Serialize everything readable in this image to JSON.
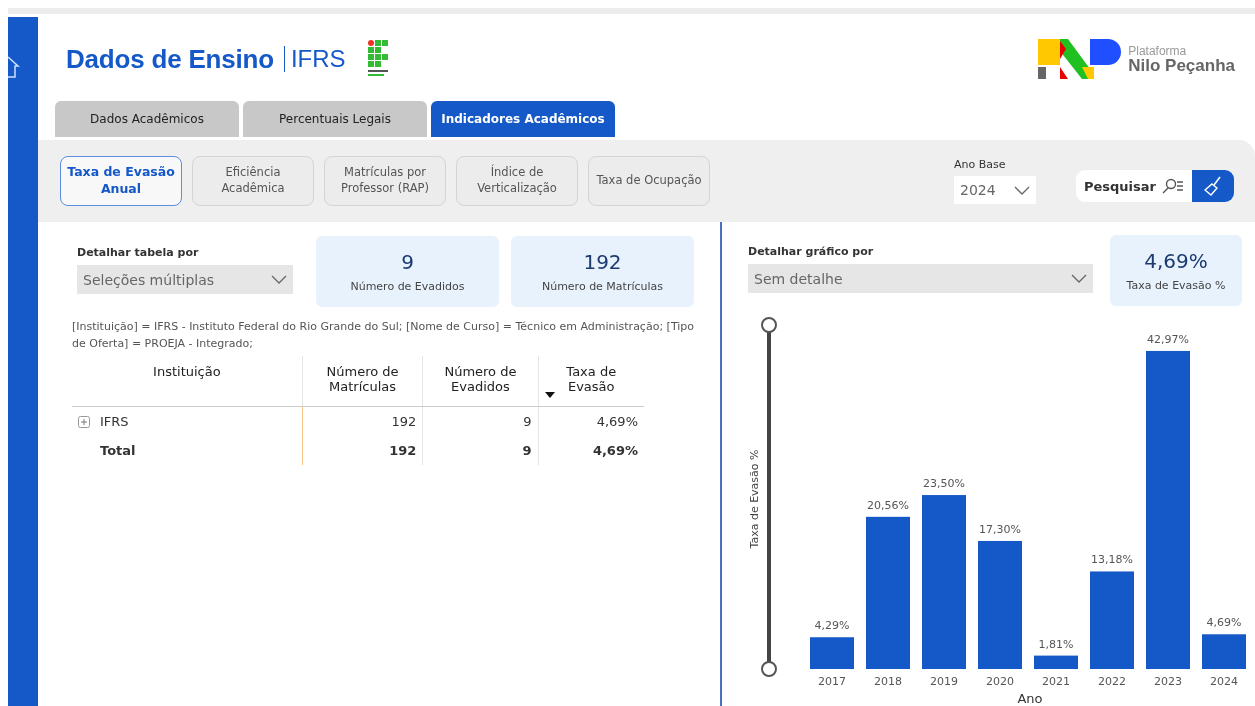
{
  "header": {
    "title": "Dados de Ensino",
    "subtitle": "IFRS",
    "brand": {
      "line1": "Plataforma",
      "line2": "Nilo Peçanha"
    }
  },
  "tabs": [
    {
      "label": "Dados Acadêmicos",
      "selected": false
    },
    {
      "label": "Percentuais Legais",
      "selected": false
    },
    {
      "label": "Indicadores Acadêmicos",
      "selected": true
    }
  ],
  "indicators": [
    {
      "label": "Taxa de Evasão Anual",
      "selected": true
    },
    {
      "label": "Eficiência Acadêmica",
      "selected": false
    },
    {
      "label": "Matrículas por Professor (RAP)",
      "selected": false
    },
    {
      "label": "Índice de Verticalização",
      "selected": false
    },
    {
      "label": "Taxa de Ocupação",
      "selected": false
    }
  ],
  "year_filter": {
    "label": "Ano Base",
    "value": "2024"
  },
  "search_button": {
    "label": "Pesquisar"
  },
  "table_panel": {
    "dropdown_label": "Detalhar tabela por",
    "dropdown_value": "Seleções múltiplas",
    "cards": [
      {
        "value": "9",
        "label": "Número de Evadidos"
      },
      {
        "value": "192",
        "label": "Número de Matrículas"
      }
    ],
    "filter_text": "[Instituição] = IFRS - Instituto Federal do Rio Grande do Sul; [Nome de Curso] = Técnico em Administração; [Tipo de Oferta] = PROEJA - Integrado;",
    "table": {
      "columns": [
        {
          "label": "Instituição",
          "sorted": false
        },
        {
          "label": "Número de Matrículas",
          "sorted": false
        },
        {
          "label": "Número de Evadidos",
          "sorted": false
        },
        {
          "label": "Taxa de Evasão",
          "sorted": true
        }
      ],
      "rows": [
        {
          "kind": "group",
          "expanded": false,
          "cells": [
            "IFRS",
            "192",
            "9",
            "4,69%"
          ]
        },
        {
          "kind": "total",
          "cells": [
            "Total",
            "192",
            "9",
            "4,69%"
          ]
        }
      ]
    }
  },
  "chart_panel": {
    "dropdown_label": "Detalhar gráfico por",
    "dropdown_value": "Sem detalhe",
    "card": {
      "value": "4,69%",
      "label": "Taxa de Evasão %"
    },
    "chart_data": {
      "type": "bar",
      "xlabel": "Ano",
      "ylabel": "Taxa de Evasão %",
      "categories": [
        "2017",
        "2018",
        "2019",
        "2020",
        "2021",
        "2022",
        "2023",
        "2024"
      ],
      "values": [
        4.29,
        20.56,
        23.5,
        17.3,
        1.81,
        13.18,
        42.97,
        4.69
      ],
      "data_labels": true,
      "value_labels": [
        "4,29%",
        "20,56%",
        "23,50%",
        "17,30%",
        "1,81%",
        "13,18%",
        "42,97%",
        "4,69%"
      ]
    }
  }
}
